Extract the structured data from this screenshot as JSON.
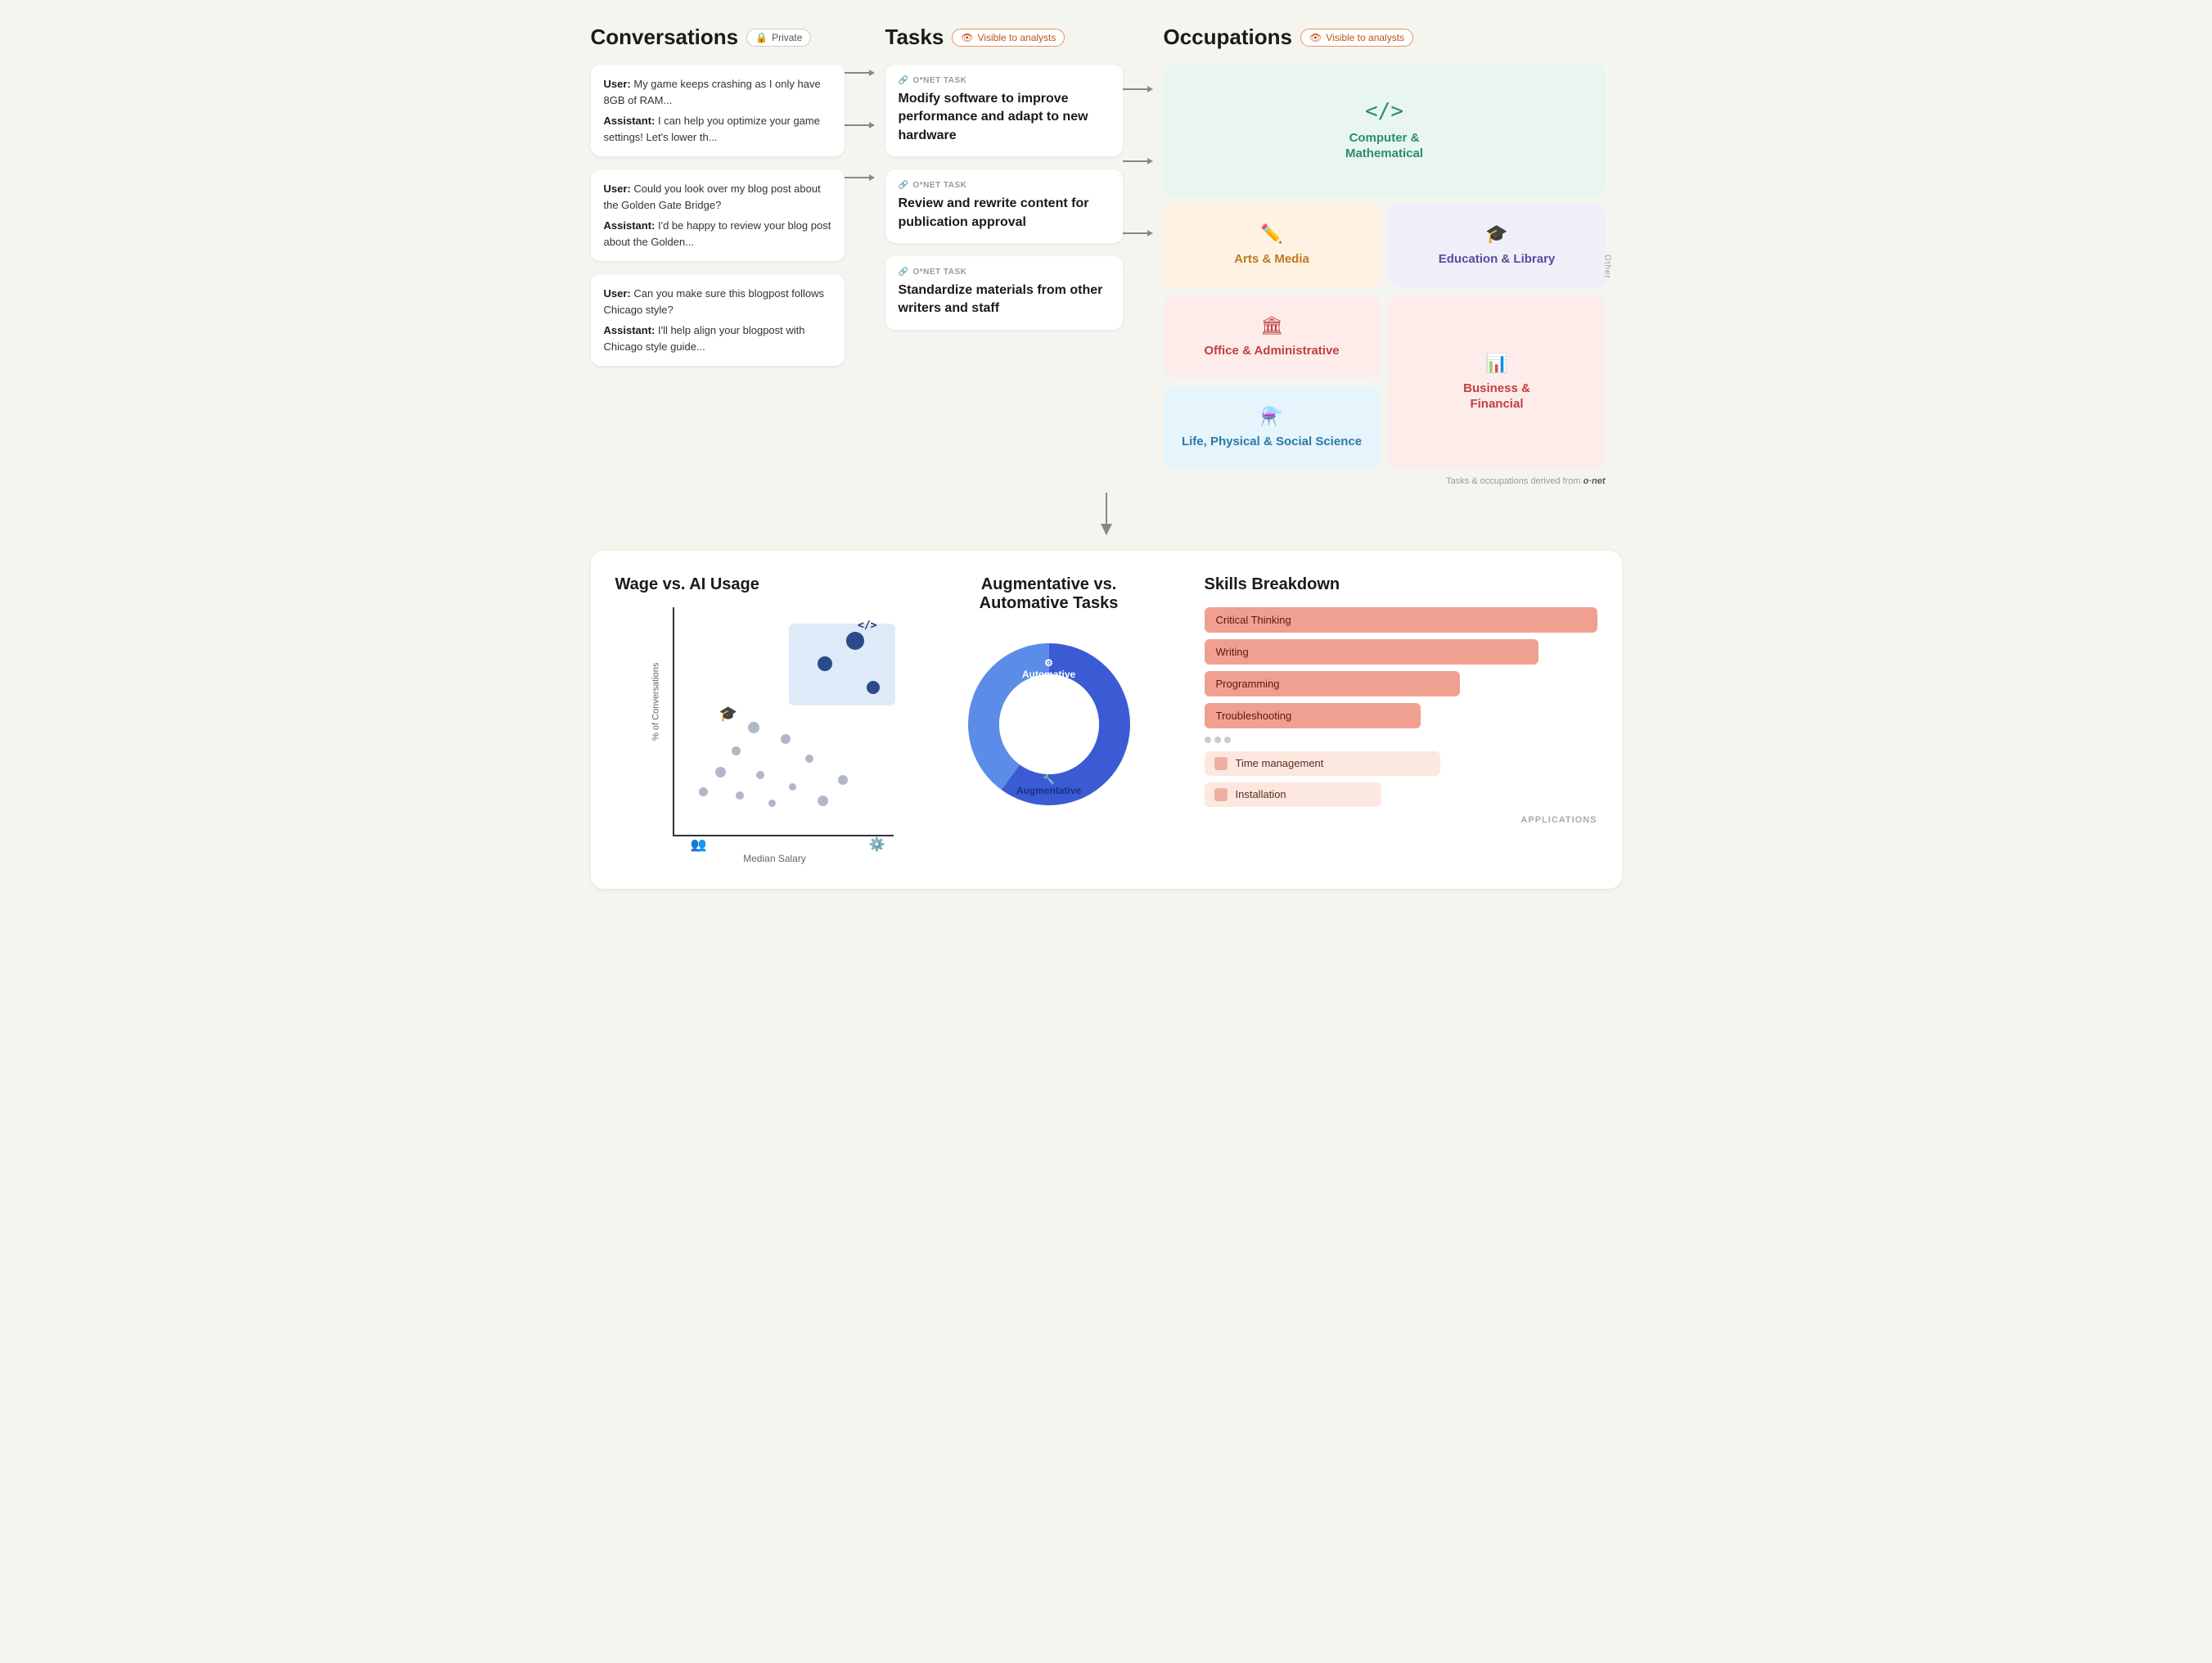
{
  "header": {
    "conversations_title": "Conversations",
    "tasks_title": "Tasks",
    "occupations_title": "Occupations",
    "private_badge": "Private",
    "visible_badge": "Visible to analysts"
  },
  "conversations": [
    {
      "user_text": "My game keeps crashing as I only have 8GB of RAM...",
      "assistant_text": "I can help you optimize your game settings! Let's lower th..."
    },
    {
      "user_text": "Could you look over my blog post about the Golden Gate Bridge?",
      "assistant_text": "I'd be happy to review your blog post about the Golden..."
    },
    {
      "user_text": "Can you make sure this blogpost follows Chicago style?",
      "assistant_text": "I'll help align your blogpost with Chicago style guide..."
    }
  ],
  "tasks": [
    {
      "label": "O*NET TASK",
      "text": "Modify software to improve performance and adapt to new hardware"
    },
    {
      "label": "O*NET TASK",
      "text": "Review and rewrite content for publication approval"
    },
    {
      "label": "O*NET TASK",
      "text": "Standardize materials from other writers and staff"
    }
  ],
  "occupations": [
    {
      "name": "Computer & Mathematical",
      "style": "computer",
      "icon": "</>",
      "large": true
    },
    {
      "name": "Arts & Media",
      "style": "arts",
      "icon": "✏️"
    },
    {
      "name": "Education & Library",
      "style": "education",
      "icon": "🎓"
    },
    {
      "name": "Office & Administrative",
      "style": "office",
      "icon": "🏛"
    },
    {
      "name": "Business & Financial",
      "style": "business",
      "icon": "📊"
    },
    {
      "name": "Life, Physical & Social Science",
      "style": "science",
      "icon": "⚗"
    }
  ],
  "onet_note": "Tasks & occupations derived from",
  "onet_brand": "o·net",
  "wage_chart": {
    "title": "Wage vs. AI Usage",
    "y_label": "% of Conversations",
    "x_label": "Median Salary"
  },
  "donut_chart": {
    "title": "Augmentative vs.\nAutomative Tasks",
    "automative_label": "Automative",
    "augmentative_label": "Augmentative",
    "automative_pct": 60,
    "augmentative_pct": 40
  },
  "skills": {
    "title": "Skills Breakdown",
    "main_skills": [
      {
        "name": "Critical Thinking",
        "width": 100
      },
      {
        "name": "Writing",
        "width": 88
      },
      {
        "name": "Programming",
        "width": 65
      },
      {
        "name": "Troubleshooting",
        "width": 58
      }
    ],
    "secondary_skills": [
      {
        "name": "Time management"
      },
      {
        "name": "Installation"
      }
    ],
    "footer": "APPLICATIONS"
  }
}
